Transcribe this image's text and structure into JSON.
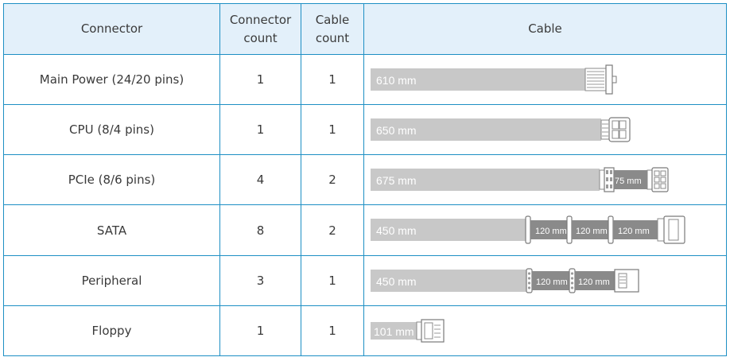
{
  "header": {
    "connector": "Connector",
    "connector_count": "Connector count",
    "cable_count": "Cable count",
    "cable": "Cable"
  },
  "rows": [
    {
      "connector": "Main Power (24/20 pins)",
      "connector_count": "1",
      "cable_count": "1",
      "cable_length": "610 mm",
      "segment_labels": [],
      "connector_icon": "24-pin-main-power-plug-icon"
    },
    {
      "connector": "CPU (8/4 pins)",
      "connector_count": "1",
      "cable_count": "1",
      "cable_length": "650 mm",
      "segment_labels": [],
      "connector_icon": "cpu-8-pin-plug-icon"
    },
    {
      "connector": "PCIe (8/6 pins)",
      "connector_count": "4",
      "cable_count": "2",
      "cable_length": "675 mm",
      "segment_labels": [
        "75 mm"
      ],
      "connector_icon": "pcie-8-pin-plug-icon"
    },
    {
      "connector": "SATA",
      "connector_count": "8",
      "cable_count": "2",
      "cable_length": "450 mm",
      "segment_labels": [
        "120 mm",
        "120 mm",
        "120 mm"
      ],
      "connector_icon": "sata-plug-icon"
    },
    {
      "connector": "Peripheral",
      "connector_count": "3",
      "cable_count": "1",
      "cable_length": "450 mm",
      "segment_labels": [
        "120 mm",
        "120 mm"
      ],
      "connector_icon": "molex-peripheral-plug-icon"
    },
    {
      "connector": "Floppy",
      "connector_count": "1",
      "cable_count": "1",
      "cable_length": "101 mm",
      "segment_labels": [],
      "connector_icon": "floppy-plug-icon"
    }
  ],
  "colors": {
    "border": "#1d8fc4",
    "header_background": "#e3f0fa",
    "cable_main": "#c8c8c8",
    "cable_segment": "#8a8a8a",
    "cable_text": "#ffffff"
  }
}
